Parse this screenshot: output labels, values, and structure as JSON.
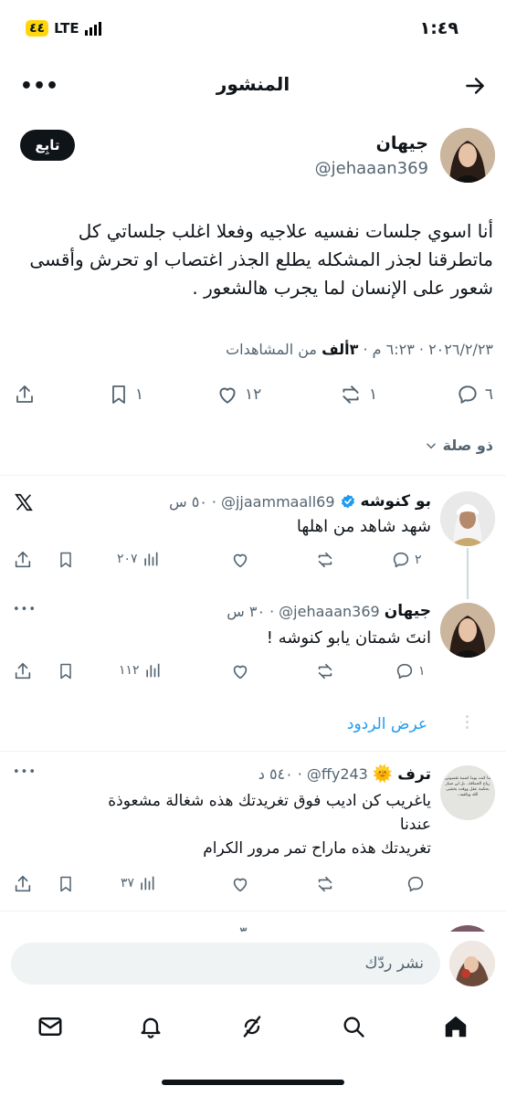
{
  "status_bar": {
    "time": "١:٤٩",
    "network": "LTE",
    "battery": "٤٤"
  },
  "header": {
    "title": "المنشور"
  },
  "post": {
    "author_name": "جيهان",
    "handle": "@jehaaan369",
    "follow_label": "تابِع",
    "text": "أنا اسوي جلسات نفسيه علاجيه وفعلا اغلب جلساتي كل ماتطرقنا لجذر المشكله يطلع الجذر اغتصاب او تحرش وأقسى شعور على  الإنسان لما يجرب هالشعور .",
    "meta_datetime": "٢٠٢٦/٢/٢٣ · ٦:٢٣ م · ",
    "views_count": "٣ألف",
    "views_label": " من المشاهدات",
    "stats": {
      "replies": "٦",
      "reposts": "١",
      "likes": "١٢",
      "bookmarks": "١"
    }
  },
  "relevance": {
    "label": "ذو صلة"
  },
  "replies": [
    {
      "name": "بو كنوشه",
      "handle": "@jjaammaall69",
      "time": "٥٠ س",
      "verified": true,
      "text": "شهد شاهد من اهلها",
      "replies": "٢",
      "reposts": "",
      "likes": "",
      "views": "٢٠٧"
    },
    {
      "name": "جيهان",
      "handle": "@jehaaan369",
      "time": "٣٠ س",
      "text": "انتَ شمتان يابو كنوشه !",
      "replies": "١",
      "reposts": "",
      "likes": "",
      "views": "١١٢"
    },
    {
      "name": "ترف",
      "emoji": "🌞",
      "handle": "@ffy243",
      "time": "٥٤٠ د",
      "text_lines": [
        "ياغريب كن اديب فوق تغريدتك هذه شغالة مشعوذة",
        "عندنا",
        "تغريدتك هذه ماراح تمر مرور الكرام"
      ],
      "replies": "",
      "reposts": "",
      "likes": "",
      "views": "٣٧",
      "avatar_text": "ما كنت يوما اضمة تقسوني رياح الحماقة.. بل لي صبار بحكمة عقل ووقت بخشى الله ويكفيه.."
    }
  ],
  "show_replies": {
    "label": "عرض الردود"
  },
  "partial_row": {
    "time": "٣"
  },
  "composer": {
    "placeholder": "نشر ردّك"
  },
  "colors": {
    "accent": "#1d9bf0",
    "text": "#0f1419",
    "muted": "#536471"
  }
}
